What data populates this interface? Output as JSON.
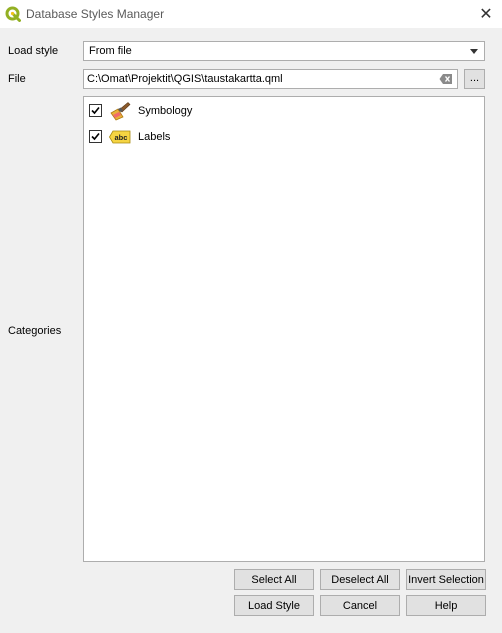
{
  "window": {
    "title": "Database Styles Manager",
    "close_glyph": "✕",
    "app_icon": "qgis-logo-icon"
  },
  "form": {
    "load_style_label": "Load style",
    "load_style_value": "From file",
    "file_label": "File",
    "file_value": "C:\\Omat\\Projektit\\QGIS\\taustakartta.qml",
    "browse_label": "...",
    "categories_label": "Categories"
  },
  "categories": [
    {
      "label": "Symbology",
      "checked": true,
      "icon": "paintbrush-icon"
    },
    {
      "label": "Labels",
      "checked": true,
      "icon": "abc-label-icon"
    }
  ],
  "buttons": {
    "select_all": "Select All",
    "deselect_all": "Deselect All",
    "invert_selection": "Invert Selection",
    "load_style": "Load Style",
    "cancel": "Cancel",
    "help": "Help"
  },
  "colors": {
    "qgis_green": "#93b023",
    "label_yellow": "#f5d442"
  }
}
